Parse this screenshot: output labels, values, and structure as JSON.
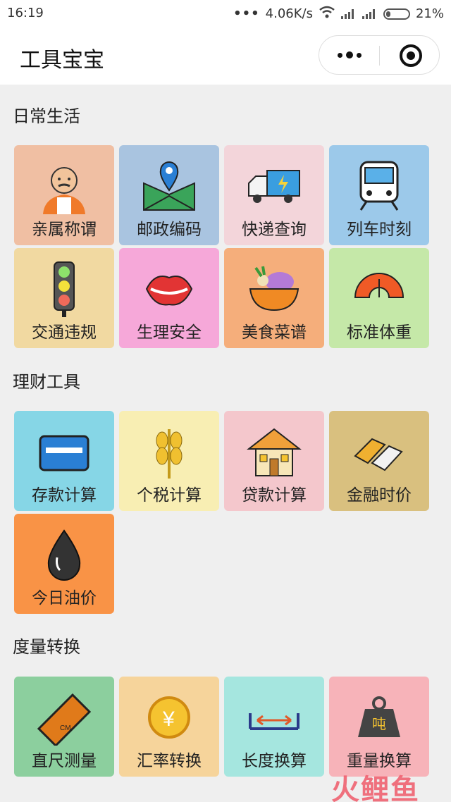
{
  "status": {
    "time": "16:19",
    "dots": "•••",
    "speed": "4.06K/s",
    "battery": "21%"
  },
  "app": {
    "title": "工具宝宝"
  },
  "sections": [
    {
      "title": "日常生活",
      "tiles": [
        {
          "label": "亲属称谓",
          "bg": "#f0bfa3",
          "icon": "elder-man-icon"
        },
        {
          "label": "邮政编码",
          "bg": "#a9c4e0",
          "icon": "map-pin-icon"
        },
        {
          "label": "快递查询",
          "bg": "#f3d5da",
          "icon": "delivery-truck-icon"
        },
        {
          "label": "列车时刻",
          "bg": "#9cc9ea",
          "icon": "train-icon"
        },
        {
          "label": "交通违规",
          "bg": "#f1d9a1",
          "icon": "traffic-light-icon"
        },
        {
          "label": "生理安全",
          "bg": "#f6a8d9",
          "icon": "lips-icon"
        },
        {
          "label": "美食菜谱",
          "bg": "#f5ae7b",
          "icon": "food-bowl-icon"
        },
        {
          "label": "标准体重",
          "bg": "#c5e8a8",
          "icon": "scale-gauge-icon"
        }
      ]
    },
    {
      "title": "理财工具",
      "tiles": [
        {
          "label": "存款计算",
          "bg": "#86d6e6",
          "icon": "bank-card-icon"
        },
        {
          "label": "个税计算",
          "bg": "#f8eeb3",
          "icon": "wheat-icon"
        },
        {
          "label": "贷款计算",
          "bg": "#f4c7cc",
          "icon": "house-icon"
        },
        {
          "label": "金融时价",
          "bg": "#d9c07f",
          "icon": "gold-bars-icon"
        },
        {
          "label": "今日油价",
          "bg": "#f99346",
          "icon": "oil-drop-icon"
        }
      ]
    },
    {
      "title": "度量转换",
      "tiles": [
        {
          "label": "直尺测量",
          "bg": "#8ccf9e",
          "icon": "ruler-icon"
        },
        {
          "label": "汇率转换",
          "bg": "#f6d49b",
          "icon": "yuan-coin-icon"
        },
        {
          "label": "长度换算",
          "bg": "#a5e6df",
          "icon": "length-arrow-icon"
        },
        {
          "label": "重量换算",
          "bg": "#f7b3b9",
          "icon": "weight-icon"
        }
      ]
    }
  ],
  "icon_text": {
    "ruler": "CM",
    "yuan": "¥",
    "weight": "吨"
  },
  "watermark": "火鲤鱼"
}
